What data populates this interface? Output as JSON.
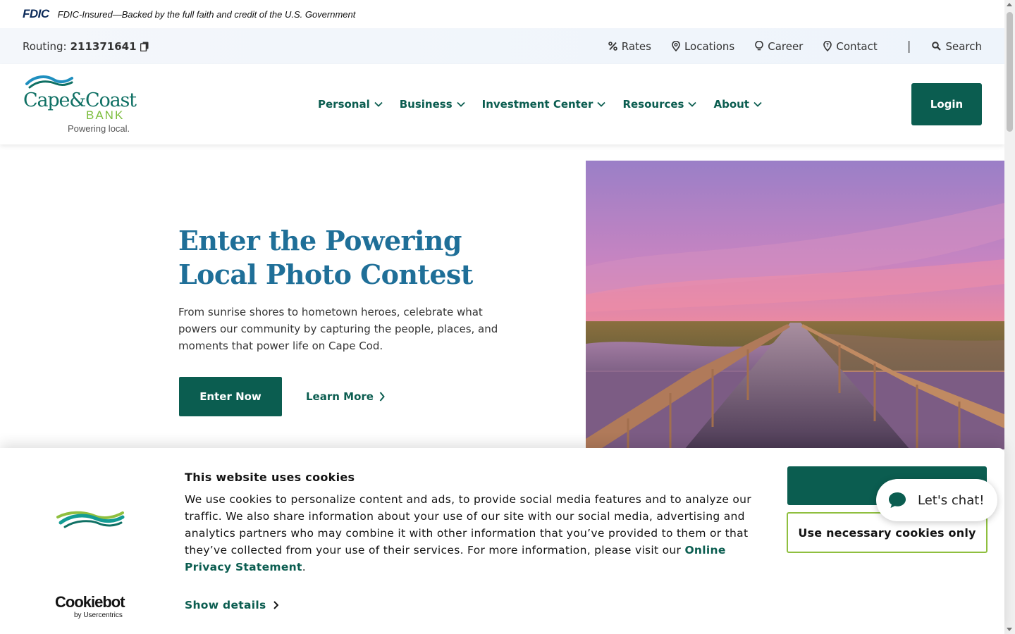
{
  "fdic": {
    "logo": "FDIC",
    "text": "FDIC-Insured—Backed by the full faith and credit of the U.S. Government"
  },
  "utility": {
    "routing_label": "Routing:",
    "routing_number": "211371641",
    "links": [
      {
        "label": "Rates",
        "icon": "percent-icon"
      },
      {
        "label": "Locations",
        "icon": "map-pin-icon"
      },
      {
        "label": "Career",
        "icon": "lightbulb-icon"
      },
      {
        "label": "Contact",
        "icon": "question-pin-icon"
      }
    ],
    "separator": "|",
    "search_label": "Search"
  },
  "brand": {
    "name": "Cape&Coast",
    "bank": "BANK",
    "tagline": "Powering local."
  },
  "nav": {
    "items": [
      "Personal",
      "Business",
      "Investment Center",
      "Resources",
      "About"
    ],
    "login": "Login"
  },
  "hero": {
    "title": "Enter the Powering Local Photo Contest",
    "text": "From sunrise shores to hometown heroes, celebrate what powers our community by capturing the people, places, and moments that power life on Cape Cod.",
    "enter_button": "Enter Now",
    "learn_more": "Learn More"
  },
  "cookie": {
    "title": "This website uses cookies",
    "body": "We use cookies to personalize content and ads, to provide social media features and to analyze our traffic. We also share information about your use of our site with our social media, advertising and analytics partners who may combine it with other information that you’ve provided to them or that they’ve collected from your use of their services. For more information, please visit our ",
    "link": "Online Privacy Statement",
    "period": ".",
    "show_details": "Show details",
    "necessary_button": "Use necessary cookies only",
    "cookiebot_name": "Cookiebot",
    "cookiebot_sub": "by Usercentrics"
  },
  "chat": {
    "label": "Let's chat!"
  },
  "colors": {
    "brand_green": "#0b5d50",
    "title_blue": "#1f6f98",
    "accent_lime": "#8fbf3f"
  }
}
